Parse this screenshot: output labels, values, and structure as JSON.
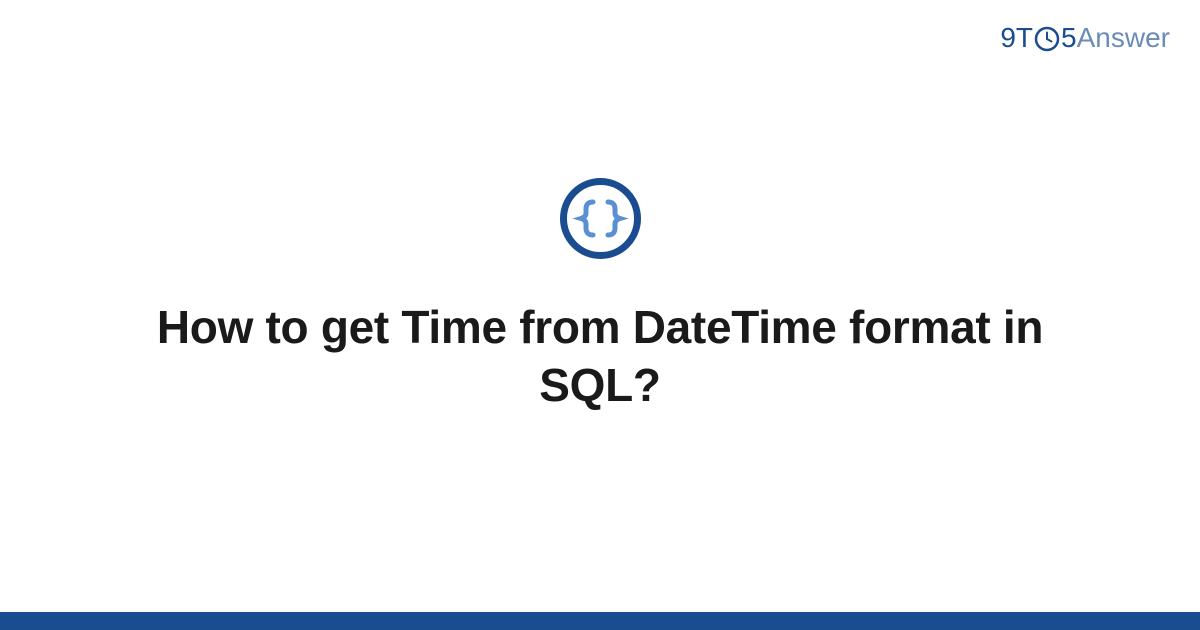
{
  "logo": {
    "part1": "9T",
    "part2": "5",
    "part3": "Answer"
  },
  "icon": {
    "name": "code-braces-icon"
  },
  "question": {
    "title": "How to get Time from DateTime format in SQL?"
  },
  "colors": {
    "brand_dark": "#1a4d8f",
    "brand_light": "#6b8cb8",
    "icon_ring": "#1a4d8f",
    "icon_brace": "#5a8fd4"
  }
}
